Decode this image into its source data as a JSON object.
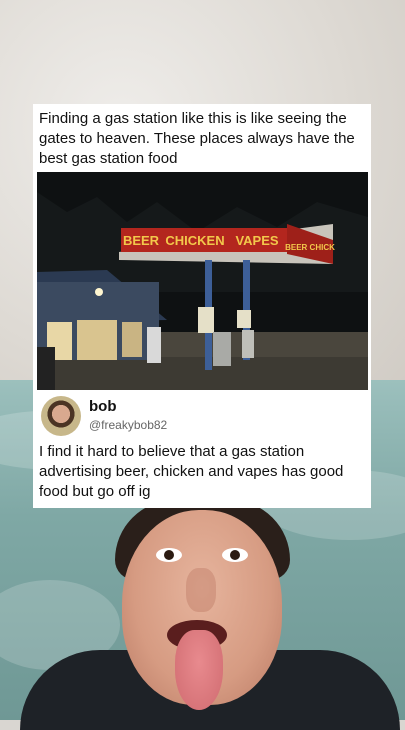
{
  "post": {
    "text": "Finding a gas station like this is like seeing the gates to heaven. These places always have the best gas station food"
  },
  "photo": {
    "canopy_sign_1": "BEER",
    "canopy_sign_2": "CHICKEN",
    "canopy_sign_3": "VAPES",
    "side_sign": "BEER CHICK"
  },
  "reply": {
    "name": "bob",
    "handle": "@freakybob82",
    "text": "I find it hard to believe that a gas station advertising beer, chicken and vapes has good food but go off ig"
  },
  "colors": {
    "sign_red": "#b3261e",
    "sign_text": "#f2c84b",
    "pole_blue": "#3d5f98"
  }
}
